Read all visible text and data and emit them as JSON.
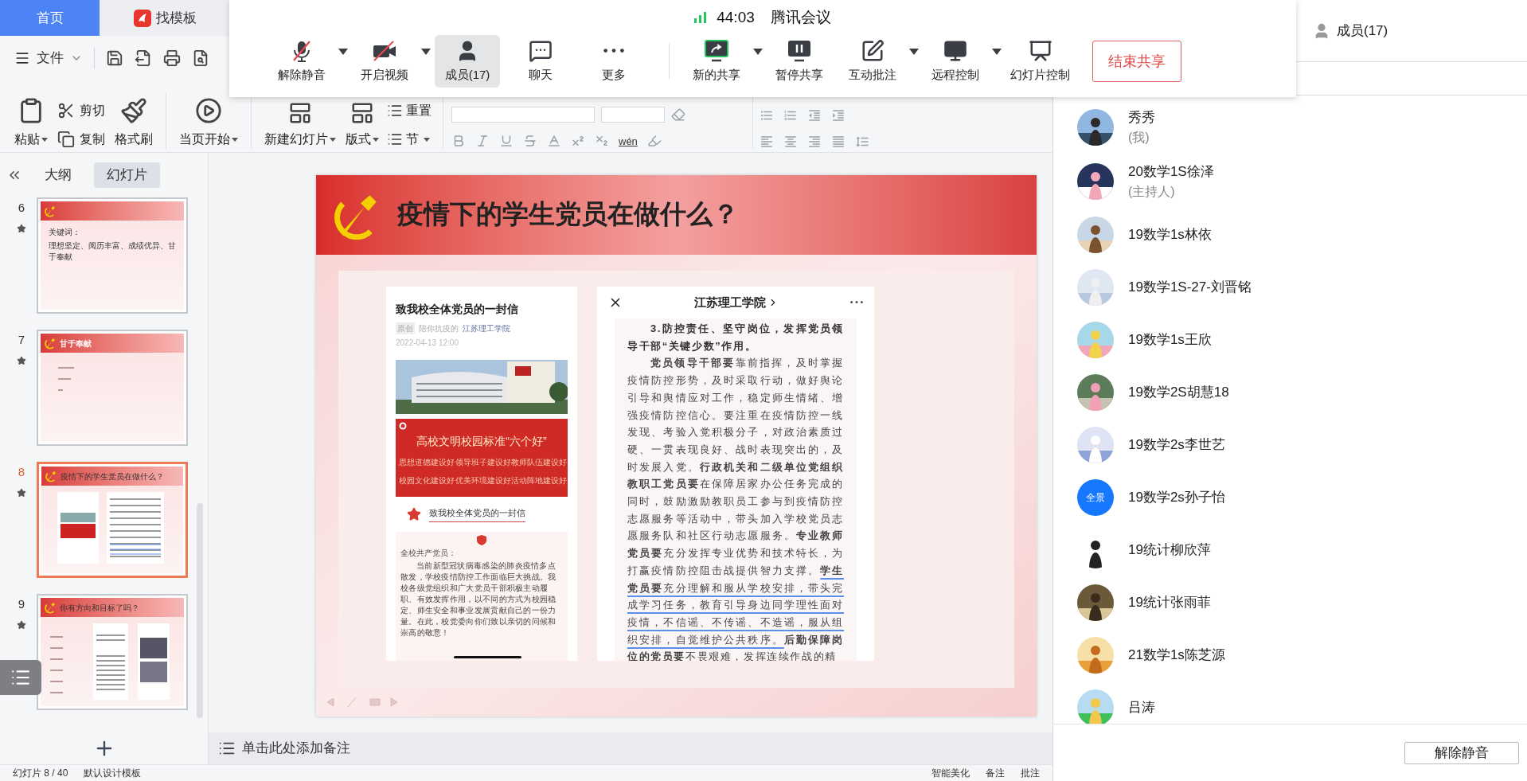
{
  "office_tabs": [
    {
      "label": "首页",
      "selected": true,
      "kind": "home"
    },
    {
      "label": "找模板",
      "selected": false,
      "kind": "template"
    }
  ],
  "quick_bar": {
    "file_menu": "文件"
  },
  "ribbon": {
    "paste": "粘贴",
    "cut": "剪切",
    "copy": "复制",
    "format_painter": "格式刷",
    "play_from_current": "当页开始",
    "new_slide": "新建幻灯片",
    "layout": "版式",
    "reset": "重置",
    "section": "节",
    "phonetic": "wén"
  },
  "meeting": {
    "duration": "44:03",
    "app_name": "腾讯会议",
    "controls": [
      {
        "label": "解除静音",
        "kind": "mic_off",
        "dropdown": true,
        "selected": false
      },
      {
        "label": "开启视频",
        "kind": "video_off",
        "dropdown": true,
        "selected": false
      },
      {
        "label": "成员(17)",
        "kind": "members",
        "dropdown": false,
        "selected": true
      },
      {
        "label": "聊天",
        "kind": "chat",
        "dropdown": false,
        "selected": false
      },
      {
        "label": "更多",
        "kind": "more",
        "dropdown": false,
        "selected": false
      },
      {
        "kind": "divider"
      },
      {
        "label": "新的共享",
        "kind": "share",
        "dropdown": true,
        "selected": false
      },
      {
        "label": "暂停共享",
        "kind": "pause",
        "dropdown": false,
        "selected": false
      },
      {
        "label": "互动批注",
        "kind": "annotate",
        "dropdown": true,
        "selected": false
      },
      {
        "label": "远程控制",
        "kind": "remote",
        "dropdown": true,
        "selected": false
      },
      {
        "label": "幻灯片控制",
        "kind": "slides",
        "dropdown": false,
        "selected": false
      }
    ],
    "end_share": "结束共享"
  },
  "slide_panel": {
    "tabs": [
      {
        "label": "大纲",
        "selected": false
      },
      {
        "label": "幻灯片",
        "selected": true
      }
    ],
    "slides": [
      {
        "number": "6",
        "selected": false,
        "kind": "text",
        "lines": [
          "关键词：",
          "理想坚定、阅历丰富、成绩优异、甘于奉献"
        ]
      },
      {
        "number": "7",
        "selected": false,
        "kind": "bullets",
        "title": "甘于奉献"
      },
      {
        "number": "8",
        "selected": true,
        "kind": "article",
        "title": "疫情下的学生党员在做什么？"
      },
      {
        "number": "9",
        "selected": false,
        "kind": "photos",
        "title": "你有方向和目标了吗？"
      }
    ]
  },
  "slide": {
    "title": "疫情下的学生党员在做什么？",
    "left_article": {
      "title": "致我校全体党员的一封信",
      "tag": "原创",
      "author": "陪你抗疫的",
      "account": "江苏理工学院",
      "date": "2022-04-13 12:00",
      "banner_title": "高校文明校园标准“六个好”",
      "banner_items": [
        "思想道德建设好",
        "领导班子建设好",
        "教师队伍建设好",
        "校园文化建设好",
        "优美环境建设好",
        "活动阵地建设好"
      ],
      "section_title": "致我校全体党员的一封信",
      "salutation": "全校共产党员：",
      "body": "当前新型冠状病毒感染的肺炎疫情多点散发，学校疫情防控工作面临巨大挑战。我校各级党组织和广大党员干部积极主动履职、有效发挥作用，以不同的方式为校园稳定、师生安全和事业发展贡献自己的一份力量。在此，校党委向你们致以亲切的问候和崇高的敬意！"
    },
    "right_article": {
      "account": "江苏理工学院",
      "heading": "3.防控责任、坚守岗位，发挥党员领导干部“关键少数”作用。",
      "body_segments": [
        {
          "annotated": false,
          "text": "**党员领导干部要**靠前指挥，及时掌握疫情防控形势，及时采取行动，做好舆论引导和舆情应对工作，稳定师生情绪、增强疫情防控信心。要注重在疫情防控一线发现、考验入党积极分子，对政治素质过硬、一贯表现良好、战时表现突出的，及时发展入党。**行政机关和二级单位党组织教职工党员要**在保障居家办公任务完成的同时，鼓励激励教职员工参与到疫情防控志愿服务等活动中，带头加入学校党员志愿服务队和社区行动志愿服务。**专业教师党员要**充分发挥专业优势和技术特长，为打赢疫情防控阻击战提供智力支撑。"
        },
        {
          "annotated": true,
          "text": "**学生党员要**充分理解和服从学校安排，带头完成学习任务，教育引导身边同学理性面对疫情，不信谣、不传谣、不造谣，服从组织安排，自觉维护公共秩序。"
        },
        {
          "annotated": false,
          "text": "**后勤保障岗位的党员要**不畏艰难，发挥连续作战的精"
        }
      ]
    }
  },
  "notes_placeholder": "单击此处添加备注",
  "status_bar": {
    "left": [
      "幻灯片 8 / 40",
      "默认设计模板"
    ],
    "right": [
      "智能美化",
      "备注",
      "批注"
    ]
  },
  "members_panel": {
    "title": "成员(17)",
    "members": [
      {
        "name": "秀秀",
        "role": "(我)"
      },
      {
        "name": "20数学1S徐泽",
        "role": "(主持人)"
      },
      {
        "name": "19数学1s林依"
      },
      {
        "name": "19数学1S-27-刘晋铭"
      },
      {
        "name": "19数学1s王欣"
      },
      {
        "name": "19数学2S胡慧18"
      },
      {
        "name": "19数学2s李世艺"
      },
      {
        "name": "19数学2s孙子怡",
        "avatar": {
          "kind": "text",
          "text": "全景"
        }
      },
      {
        "name": "19统计柳欣萍"
      },
      {
        "name": "19统计张雨菲"
      },
      {
        "name": "21数学1s陈芝源"
      },
      {
        "name": "吕涛"
      }
    ],
    "unmute_all": "解除静音"
  }
}
